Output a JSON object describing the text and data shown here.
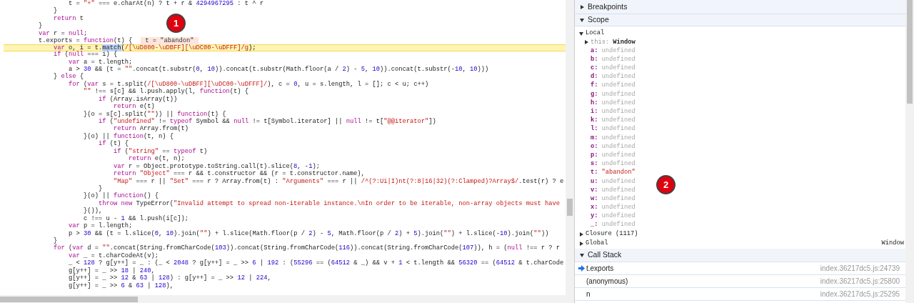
{
  "editor": {
    "lines": [
      {
        "code": "                t = \"+\" === e.charAt(n) ? t + r & 4294967295 : t ^ r",
        "current": false
      },
      {
        "code": "            }",
        "current": false
      },
      {
        "code": "            return t",
        "current": false
      },
      {
        "code": "        }",
        "current": false
      },
      {
        "code": "        var r = null;",
        "current": false
      },
      {
        "code": "        t.exports = function(t) {",
        "current": false,
        "inline_value": "t = \"abandon\""
      },
      {
        "code": "            var o, i = t.",
        "selection": "match",
        "code_after": "(/[\\uD800-\\uDBFF][\\uDC00-\\uDFFF]/g);",
        "current": true
      },
      {
        "code": "            if (null === i) {",
        "current": false
      },
      {
        "code": "                var a = t.length;",
        "current": false
      },
      {
        "code": "                a > 30 && (t = \"\".concat(t.substr(0, 10)).concat(t.substr(Math.floor(a / 2) - 5, 10)).concat(t.substr(-10, 10)))",
        "current": false
      },
      {
        "code": "            } else {",
        "current": false
      },
      {
        "code": "                for (var s = t.split(/[\\uD800-\\uDBFF][\\uDC00-\\uDFFF]/), c = 0, u = s.length, l = []; c < u; c++)",
        "current": false
      },
      {
        "code": "                    \"\" !== s[c] && l.push.apply(l, function(t) {",
        "current": false
      },
      {
        "code": "                        if (Array.isArray(t))",
        "current": false
      },
      {
        "code": "                            return e(t)",
        "current": false
      },
      {
        "code": "                    }(o = s[c].split(\"\")) || function(t) {",
        "current": false
      },
      {
        "code": "                        if (\"undefined\" != typeof Symbol && null != t[Symbol.iterator] || null != t[\"@@iterator\"])",
        "current": false
      },
      {
        "code": "                            return Array.from(t)",
        "current": false
      },
      {
        "code": "                    }(o) || function(t, n) {",
        "current": false
      },
      {
        "code": "                        if (t) {",
        "current": false
      },
      {
        "code": "                            if (\"string\" == typeof t)",
        "current": false
      },
      {
        "code": "                                return e(t, n);",
        "current": false
      },
      {
        "code": "                            var r = Object.prototype.toString.call(t).slice(8, -1);",
        "current": false
      },
      {
        "code": "                            return \"Object\" === r && t.constructor && (r = t.constructor.name),",
        "current": false
      },
      {
        "code": "                            \"Map\" === r || \"Set\" === r ? Array.from(t) : \"Arguments\" === r || /^(?:Ui|I)nt(?:8|16|32)(?:Clamped)?Array$/.test(r) ? e",
        "current": false
      },
      {
        "code": "                        }",
        "current": false
      },
      {
        "code": "                    }(o) || function() {",
        "current": false
      },
      {
        "code": "                        throw new TypeError(\"Invalid attempt to spread non-iterable instance.\\nIn order to be iterable, non-array objects must have",
        "current": false
      },
      {
        "code": "                    }()),",
        "current": false
      },
      {
        "code": "                    c !== u - 1 && l.push(i[c]);",
        "current": false
      },
      {
        "code": "                var p = l.length;",
        "current": false
      },
      {
        "code": "                p > 30 && (t = l.slice(0, 10).join(\"\") + l.slice(Math.floor(p / 2) - 5, Math.floor(p / 2) + 5).join(\"\") + l.slice(-10).join(\"\"))",
        "current": false
      },
      {
        "code": "            }",
        "current": false
      },
      {
        "code": "            for (var d = \"\".concat(String.fromCharCode(103)).concat(String.fromCharCode(116)).concat(String.fromCharCode(107)), h = (null !== r ? r",
        "current": false
      },
      {
        "code": "                var _ = t.charCodeAt(v);",
        "current": false
      },
      {
        "code": "                _ < 128 ? g[y++] = _ : (_ < 2048 ? g[y++] = _ >> 6 | 192 : (55296 == (64512 & _) && v + 1 < t.length && 56320 == (64512 & t.charCode",
        "current": false
      },
      {
        "code": "                g[y++] = _ >> 18 | 240,",
        "current": false
      },
      {
        "code": "                g[y++] = _ >> 12 & 63 | 128) : g[y++] = _ >> 12 | 224,",
        "current": false
      },
      {
        "code": "                g[y++] = _ >> 6 & 63 | 128),",
        "current": false
      }
    ]
  },
  "annotations": [
    "1",
    "2"
  ],
  "breakpoints": {
    "title": "Breakpoints",
    "expanded": false
  },
  "scope": {
    "title": "Scope",
    "expanded": true,
    "groups": [
      {
        "name": "Local",
        "expanded": true,
        "children": [
          {
            "name": "this:",
            "value": "Window",
            "kind": "object"
          },
          {
            "name": "a:",
            "value": "undefined",
            "kind": "undefined"
          },
          {
            "name": "b:",
            "value": "undefined",
            "kind": "undefined"
          },
          {
            "name": "c:",
            "value": "undefined",
            "kind": "undefined"
          },
          {
            "name": "d:",
            "value": "undefined",
            "kind": "undefined"
          },
          {
            "name": "f:",
            "value": "undefined",
            "kind": "undefined"
          },
          {
            "name": "g:",
            "value": "undefined",
            "kind": "undefined"
          },
          {
            "name": "h:",
            "value": "undefined",
            "kind": "undefined"
          },
          {
            "name": "i:",
            "value": "undefined",
            "kind": "undefined"
          },
          {
            "name": "k:",
            "value": "undefined",
            "kind": "undefined"
          },
          {
            "name": "l:",
            "value": "undefined",
            "kind": "undefined"
          },
          {
            "name": "m:",
            "value": "undefined",
            "kind": "undefined"
          },
          {
            "name": "o:",
            "value": "undefined",
            "kind": "undefined"
          },
          {
            "name": "p:",
            "value": "undefined",
            "kind": "undefined"
          },
          {
            "name": "s:",
            "value": "undefined",
            "kind": "undefined"
          },
          {
            "name": "t:",
            "value": "\"abandon\"",
            "kind": "string"
          },
          {
            "name": "u:",
            "value": "undefined",
            "kind": "undefined"
          },
          {
            "name": "v:",
            "value": "undefined",
            "kind": "undefined"
          },
          {
            "name": "w:",
            "value": "undefined",
            "kind": "undefined"
          },
          {
            "name": "x:",
            "value": "undefined",
            "kind": "undefined"
          },
          {
            "name": "y:",
            "value": "undefined",
            "kind": "undefined"
          },
          {
            "name": "_:",
            "value": "undefined",
            "kind": "undefined"
          }
        ]
      },
      {
        "name": "Closure (1117)",
        "expanded": false
      },
      {
        "name": "Global",
        "expanded": false,
        "value": "Window"
      }
    ]
  },
  "call_stack": {
    "title": "Call Stack",
    "expanded": true,
    "frames": [
      {
        "name": "t.exports",
        "location": "index.36217dc5.js:24739",
        "current": true
      },
      {
        "name": "(anonymous)",
        "location": "index.36217dc5.js:25800",
        "current": false
      },
      {
        "name": "n",
        "location": "index.36217dc5.js:25295",
        "current": false
      }
    ]
  }
}
